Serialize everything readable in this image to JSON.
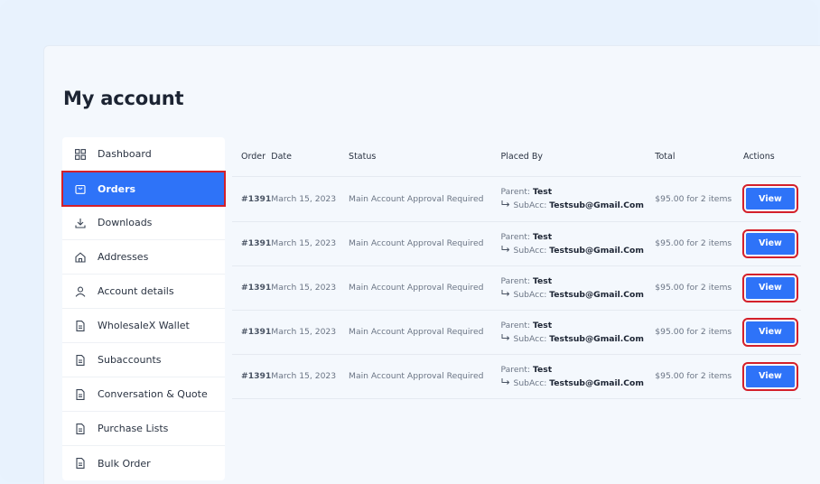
{
  "page": {
    "title": "My account"
  },
  "sidebar": {
    "items": [
      {
        "label": "Dashboard",
        "icon": "grid-icon",
        "active": false
      },
      {
        "label": "Orders",
        "icon": "bag-icon",
        "active": true
      },
      {
        "label": "Downloads",
        "icon": "download-icon",
        "active": false
      },
      {
        "label": "Addresses",
        "icon": "home-icon",
        "active": false
      },
      {
        "label": "Account details",
        "icon": "user-icon",
        "active": false
      },
      {
        "label": "WholesaleX Wallet",
        "icon": "document-icon",
        "active": false
      },
      {
        "label": "Subaccounts",
        "icon": "document-icon",
        "active": false
      },
      {
        "label": "Conversation & Quote",
        "icon": "document-icon",
        "active": false
      },
      {
        "label": "Purchase Lists",
        "icon": "document-icon",
        "active": false
      },
      {
        "label": "Bulk Order",
        "icon": "document-icon",
        "active": false
      }
    ]
  },
  "table": {
    "headers": {
      "order": "Order",
      "date": "Date",
      "status": "Status",
      "placed_by": "Placed By",
      "total": "Total",
      "actions": "Actions"
    },
    "rows": [
      {
        "order": "#1391",
        "date": "March 15, 2023",
        "status": "Main Account Approval Required",
        "parent_label": "Parent:",
        "parent": "Test",
        "subacc_label": "SubAcc:",
        "subacc": "Testsub@Gmail.Com",
        "total": "$95.00 for 2 items",
        "action": "View"
      },
      {
        "order": "#1391",
        "date": "March 15, 2023",
        "status": "Main Account Approval Required",
        "parent_label": "Parent:",
        "parent": "Test",
        "subacc_label": "SubAcc:",
        "subacc": "Testsub@Gmail.Com",
        "total": "$95.00 for 2 items",
        "action": "View"
      },
      {
        "order": "#1391",
        "date": "March 15, 2023",
        "status": "Main Account Approval Required",
        "parent_label": "Parent:",
        "parent": "Test",
        "subacc_label": "SubAcc:",
        "subacc": "Testsub@Gmail.Com",
        "total": "$95.00 for 2 items",
        "action": "View"
      },
      {
        "order": "#1391",
        "date": "March 15, 2023",
        "status": "Main Account Approval Required",
        "parent_label": "Parent:",
        "parent": "Test",
        "subacc_label": "SubAcc:",
        "subacc": "Testsub@Gmail.Com",
        "total": "$95.00 for 2 items",
        "action": "View"
      },
      {
        "order": "#1391",
        "date": "March 15, 2023",
        "status": "Main Account Approval Required",
        "parent_label": "Parent:",
        "parent": "Test",
        "subacc_label": "SubAcc:",
        "subacc": "Testsub@Gmail.Com",
        "total": "$95.00 for 2 items",
        "action": "View"
      }
    ]
  },
  "colors": {
    "accent": "#2e73f8",
    "highlight_outline": "#d4202a"
  }
}
